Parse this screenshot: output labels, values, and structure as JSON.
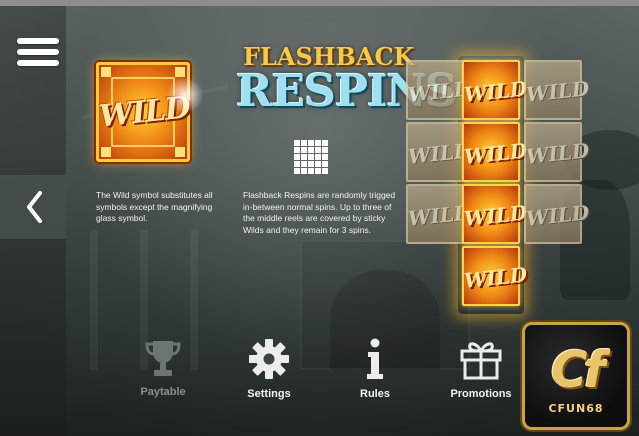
{
  "menu": {
    "icon": "hamburger-menu-icon"
  },
  "navigation": {
    "prev_icon": "chevron-left-icon"
  },
  "wild": {
    "symbol_text": "WILD",
    "description": "The Wild symbol substitutes all symbols except the magnifying glass symbol."
  },
  "feature": {
    "logo_line1": "FLASHBACK",
    "logo_line2": "RESPINS",
    "grid_icon": "reel-grid-icon",
    "description": "Flashback Respins are randomly trigged in-between normal spins. Up to three of the middle reels are covered by sticky Wilds and they remain for 3 spins."
  },
  "reels": {
    "symbol_text": "WILD",
    "columns": [
      {
        "highlighted": false,
        "rows": 3
      },
      {
        "highlighted": true,
        "rows": 4
      },
      {
        "highlighted": false,
        "rows": 3
      }
    ]
  },
  "bottom_nav": {
    "items": [
      {
        "label": "Paytable",
        "icon": "trophy-icon",
        "enabled": false
      },
      {
        "label": "Settings",
        "icon": "gear-icon",
        "enabled": true
      },
      {
        "label": "Rules",
        "icon": "info-icon",
        "enabled": true
      },
      {
        "label": "Promotions",
        "icon": "gift-icon",
        "enabled": true
      }
    ]
  },
  "watermark": {
    "logo": "Cf",
    "text": "CFUN68"
  },
  "colors": {
    "gold": "#f08a14",
    "highlight": "#ffd13a",
    "logo_teal": "#9fe0f0",
    "logo_gold": "#f7c948",
    "badge_border": "#caa24a"
  }
}
